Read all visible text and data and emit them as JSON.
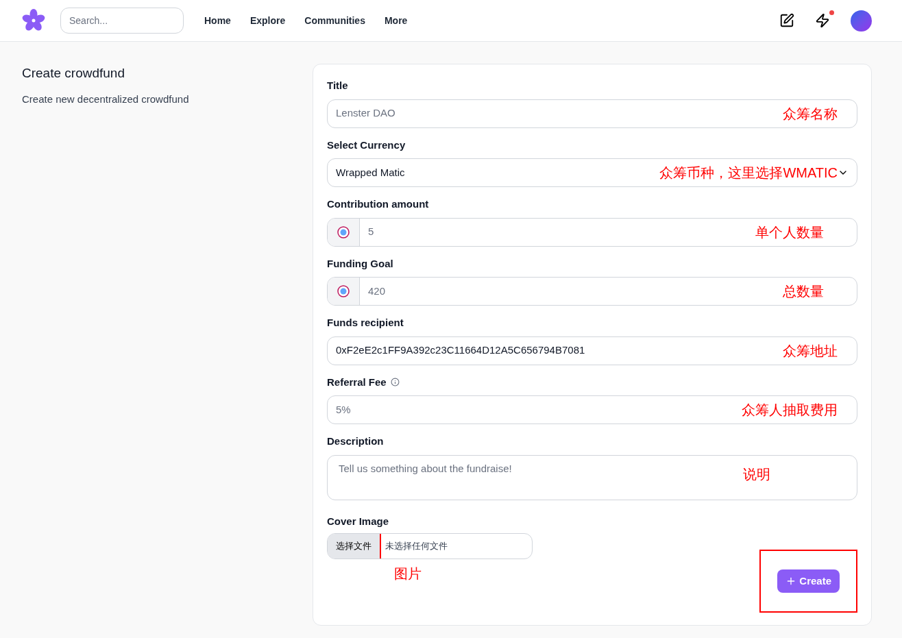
{
  "nav": {
    "search": {
      "placeholder": "Search..."
    },
    "links": [
      "Home",
      "Explore",
      "Communities",
      "More"
    ],
    "notification_dot": true
  },
  "sidebar": {
    "title": "Create crowdfund",
    "subtitle": "Create new decentralized crowdfund"
  },
  "form": {
    "fields": [
      {
        "kind": "text",
        "label": "Title",
        "placeholder": "Lenster DAO",
        "annotation": "众筹名称"
      },
      {
        "kind": "select",
        "label": "Select Currency",
        "value": "Wrapped Matic",
        "annotation": "众筹币种，这里选择WMATIC"
      },
      {
        "kind": "token",
        "label": "Contribution amount",
        "placeholder": "5",
        "annotation": "单个人数量"
      },
      {
        "kind": "token",
        "label": "Funding Goal",
        "placeholder": "420",
        "annotation": "总数量"
      },
      {
        "kind": "text",
        "label": "Funds recipient",
        "value": "0xF2eE2c1FF9A392c23C11664D12A5C656794B7081",
        "annotation": "众筹地址"
      },
      {
        "kind": "text",
        "label": "Referral Fee",
        "info": true,
        "placeholder": "5%",
        "annotation": "众筹人抽取费用"
      },
      {
        "kind": "textarea",
        "label": "Description",
        "placeholder": "Tell us something about the fundraise!",
        "annotation": "说明"
      }
    ],
    "cover": {
      "label": "Cover Image",
      "button": "选择文件",
      "status": "未选择任何文件",
      "highlighted": true,
      "annotation": "图片"
    },
    "submit": {
      "label": "Create",
      "highlighted": true
    }
  }
}
